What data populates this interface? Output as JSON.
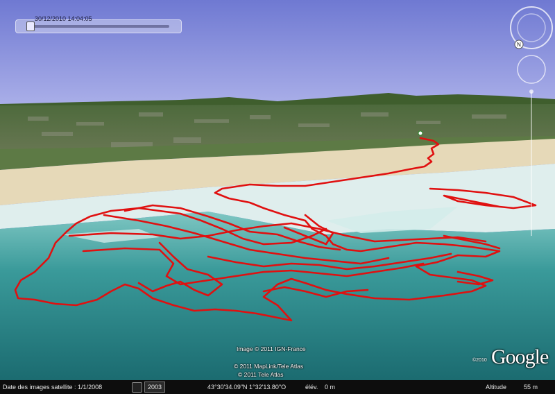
{
  "time_slider": {
    "timestamp": "30/12/2010  14:04:05"
  },
  "map": {
    "track_color": "#e01010",
    "sky_color": "#7b83d6",
    "sea_color": "#2f8a8c",
    "sand_color": "#e6d9b8"
  },
  "navigation": {
    "north_label": "N",
    "compass_icon": "compass-ring-icon",
    "look_icon": "look-joystick-icon",
    "zoom_icon": "zoom-slider-icon"
  },
  "credits": {
    "line1": "Image © 2011 IGN-France",
    "line2": "© 2011 MapLink/Tele Atlas",
    "line3": "© 2011 Tele Atlas"
  },
  "logo": {
    "year": "©2010",
    "text": "Google"
  },
  "status_bar": {
    "imagery_date": "Date des images satellite : 1/1/2008",
    "year_button": "2003",
    "coordinates": "43°30'34.09\"N    1°32'13.80\"O",
    "elev_label": "élév.",
    "elev_value": "0 m",
    "altitude_label": "Altitude",
    "altitude_value": "55 m"
  }
}
